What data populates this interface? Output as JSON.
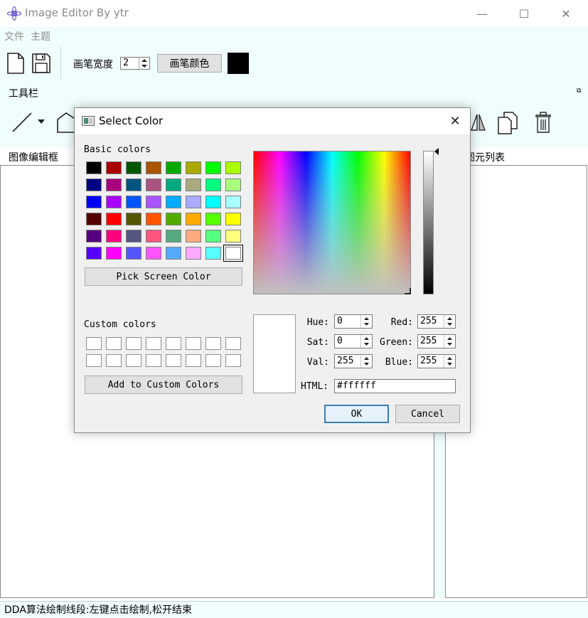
{
  "window": {
    "title": "Image Editor By ytr",
    "min_glyph": "—",
    "max_glyph": "☐",
    "close_glyph": "✕"
  },
  "menu": [
    "文件",
    "主题"
  ],
  "toolbar": {
    "pen_width_label": "画笔宽度",
    "pen_width_value": "2",
    "pen_color_button": "画笔颜色",
    "pen_color": "#000000"
  },
  "dock": {
    "tools_title": "工具栏",
    "float_glyph": "⧉",
    "canvas_title": "图像编辑框",
    "list_title": "图元列表"
  },
  "status": "DDA算法绘制线段:左键点击绘制,松开结束",
  "dialog": {
    "title": "Select Color",
    "close_glyph": "✕",
    "basic_colors_label": "Basic colors",
    "basic_colors": [
      "#000000",
      "#aa0000",
      "#005500",
      "#aa5500",
      "#00aa00",
      "#aaaa00",
      "#00ff00",
      "#aaff00",
      "#000080",
      "#aa007f",
      "#00557f",
      "#aa557f",
      "#00aa7f",
      "#aaaa7f",
      "#00ff7f",
      "#aaff7f",
      "#0000ff",
      "#aa00ff",
      "#0055ff",
      "#aa55ff",
      "#00aaff",
      "#aaaaff",
      "#00ffff",
      "#aaffff",
      "#550000",
      "#ff0000",
      "#555500",
      "#ff5500",
      "#55aa00",
      "#ffaa00",
      "#55ff00",
      "#ffff00",
      "#55007f",
      "#ff007f",
      "#55557f",
      "#ff557f",
      "#55aa7f",
      "#ffaa7f",
      "#55ff7f",
      "#ffff7f",
      "#5500ff",
      "#ff00ff",
      "#5555ff",
      "#ff55ff",
      "#55aaff",
      "#ffaaff",
      "#55ffff",
      "#ffffff"
    ],
    "selected_basic_index": 47,
    "pick_screen_label": "Pick Screen Color",
    "custom_colors_label": "Custom colors",
    "add_custom_label": "Add to Custom Colors",
    "hue_label": "Hue:",
    "hue": "0",
    "sat_label": "Sat:",
    "sat": "0",
    "val_label": "Val:",
    "val": "255",
    "red_label": "Red:",
    "red": "255",
    "green_label": "Green:",
    "green": "255",
    "blue_label": "Blue:",
    "blue": "255",
    "html_label": "HTML:",
    "html": "#ffffff",
    "current_color": "#ffffff",
    "ok_label": "OK",
    "cancel_label": "Cancel"
  }
}
